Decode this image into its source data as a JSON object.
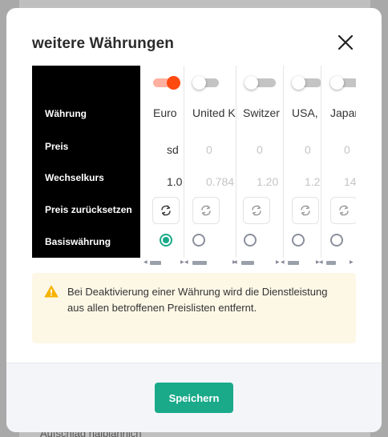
{
  "background": {
    "text": "Aufschlag halbjährlich"
  },
  "modal": {
    "title": "weitere Währungen"
  },
  "row_labels": [
    "Währung",
    "Preis",
    "Wechselkurs",
    "Preis zurücksetzen",
    "Basiswährung"
  ],
  "currencies": [
    {
      "name": "Euro",
      "price": "sd",
      "rate": "1.0",
      "enabled": true,
      "base": true
    },
    {
      "name": "United K",
      "price": "0",
      "rate": "0.784",
      "enabled": false,
      "base": false
    },
    {
      "name": "Switzer",
      "price": "0",
      "rate": "1.20",
      "enabled": false,
      "base": false
    },
    {
      "name": "USA,",
      "price": "0",
      "rate": "1.2",
      "enabled": false,
      "base": false
    },
    {
      "name": "Japan",
      "price": "0",
      "rate": "14",
      "enabled": false,
      "base": false
    }
  ],
  "alert": {
    "icon": "warning-triangle-icon",
    "text": "Bei Deaktivierung einer Währung wird die Dienstleistung aus allen betroffenen Preislisten entfernt."
  },
  "footer": {
    "save_label": "Speichern"
  },
  "colors": {
    "primary": "#1aaa8a",
    "toggle_on": "#ff4a10",
    "alert_bg": "#fdf7e6",
    "warning": "#f5b400"
  }
}
